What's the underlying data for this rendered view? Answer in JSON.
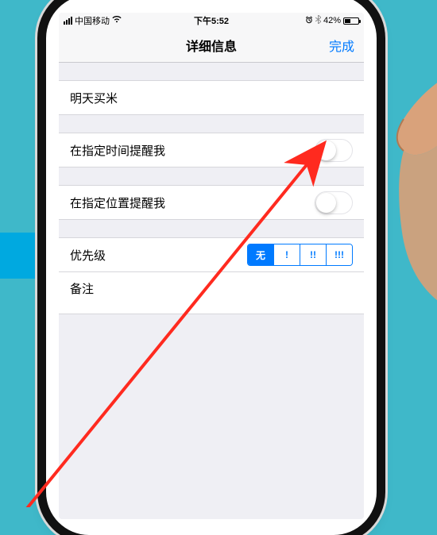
{
  "status": {
    "carrier": "中国移动",
    "time": "下午5:52",
    "battery_pct": "42%"
  },
  "nav": {
    "title": "详细信息",
    "done": "完成"
  },
  "reminder": {
    "title": "明天买米"
  },
  "rows": {
    "remind_time": {
      "label": "在指定时间提醒我",
      "on": false
    },
    "remind_location": {
      "label": "在指定位置提醒我",
      "on": false
    },
    "priority": {
      "label": "优先级",
      "options": [
        "无",
        "!",
        "!!",
        "!!!"
      ],
      "selected_index": 0
    },
    "notes": {
      "label": "备注"
    }
  }
}
